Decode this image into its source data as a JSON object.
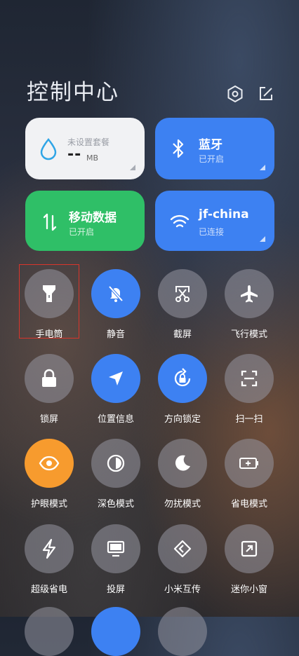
{
  "header": {
    "title": "控制中心"
  },
  "cards": {
    "data_plan": {
      "label": "未设置套餐",
      "value": "--",
      "unit": "MB"
    },
    "bluetooth": {
      "label": "蓝牙",
      "status": "已开启"
    },
    "mobile_data": {
      "label": "移动数据",
      "status": "已开启"
    },
    "wifi": {
      "label": "jf-china",
      "status": "已连接"
    }
  },
  "toggles": [
    {
      "label": "手电筒",
      "icon": "flashlight-icon",
      "state": "off"
    },
    {
      "label": "静音",
      "icon": "mute-bell-icon",
      "state": "on"
    },
    {
      "label": "截屏",
      "icon": "screenshot-scissors-icon",
      "state": "off"
    },
    {
      "label": "飞行模式",
      "icon": "airplane-icon",
      "state": "off"
    },
    {
      "label": "锁屏",
      "icon": "lock-icon",
      "state": "off"
    },
    {
      "label": "位置信息",
      "icon": "location-arrow-icon",
      "state": "on"
    },
    {
      "label": "方向锁定",
      "icon": "rotation-lock-icon",
      "state": "on"
    },
    {
      "label": "扫一扫",
      "icon": "scan-icon",
      "state": "off"
    },
    {
      "label": "护眼模式",
      "icon": "eye-icon",
      "state": "on"
    },
    {
      "label": "深色模式",
      "icon": "dark-mode-icon",
      "state": "off"
    },
    {
      "label": "勿扰模式",
      "icon": "moon-icon",
      "state": "off"
    },
    {
      "label": "省电模式",
      "icon": "battery-saver-icon",
      "state": "off"
    },
    {
      "label": "超级省电",
      "icon": "lightning-icon",
      "state": "off"
    },
    {
      "label": "投屏",
      "icon": "cast-screen-icon",
      "state": "off"
    },
    {
      "label": "小米互传",
      "icon": "mi-share-icon",
      "state": "off"
    },
    {
      "label": "迷你小窗",
      "icon": "mini-window-icon",
      "state": "off"
    }
  ],
  "colors": {
    "active_blue": "#3d81f2",
    "active_green": "#2fbf67",
    "active_orange": "#f79b2e"
  }
}
